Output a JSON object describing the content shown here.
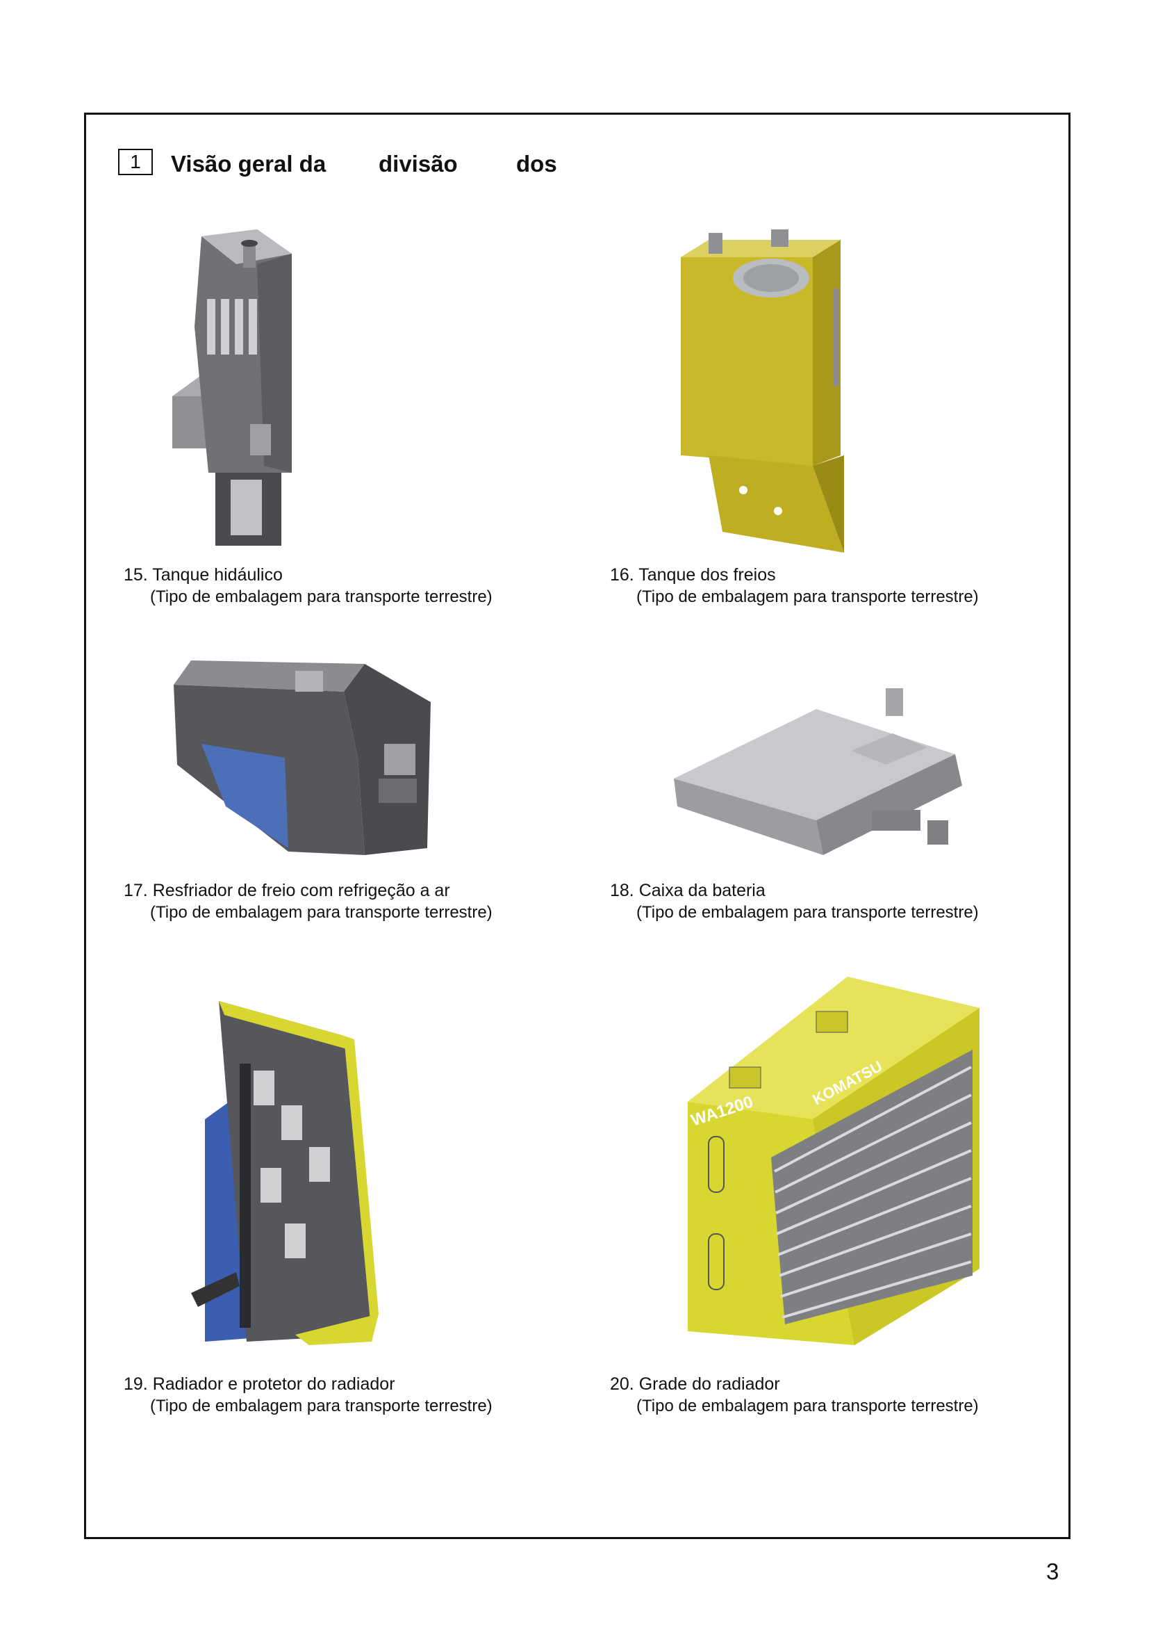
{
  "section": {
    "number": "1",
    "title_parts": [
      "Visão geral  da",
      "divisão",
      "dos"
    ]
  },
  "items": [
    {
      "caption": "15. Tanque hidáulico",
      "subcaption": "(Tipo de embalagem para transporte terrestre)",
      "image_icon": "hydraulic-tank-illustration"
    },
    {
      "caption": "16. Tanque dos freios",
      "subcaption": "(Tipo de embalagem para transporte terrestre)",
      "image_icon": "brake-tank-illustration"
    },
    {
      "caption": "17. Resfriador de freio com refrigeção a ar",
      "subcaption": "(Tipo de embalagem para transporte terrestre)",
      "image_icon": "brake-cooler-illustration"
    },
    {
      "caption": "18. Caixa da bateria",
      "subcaption": "(Tipo de embalagem para transporte terrestre)",
      "image_icon": "battery-box-illustration"
    },
    {
      "caption": "19. Radiador e protetor do radiador",
      "subcaption": "(Tipo de embalagem para transporte terrestre)",
      "image_icon": "radiator-guard-illustration"
    },
    {
      "caption": "20. Grade do radiador",
      "subcaption": "(Tipo de embalagem para transporte terrestre)",
      "image_icon": "radiator-grille-illustration"
    }
  ],
  "grille_branding": {
    "brand": "KOMATSU",
    "model": "WA1200"
  },
  "page_number": "3",
  "colors": {
    "komatsu_yellow": "#d8d630",
    "gray_metal": "#7a7c80",
    "cooler_blue": "#4c6fb8"
  }
}
